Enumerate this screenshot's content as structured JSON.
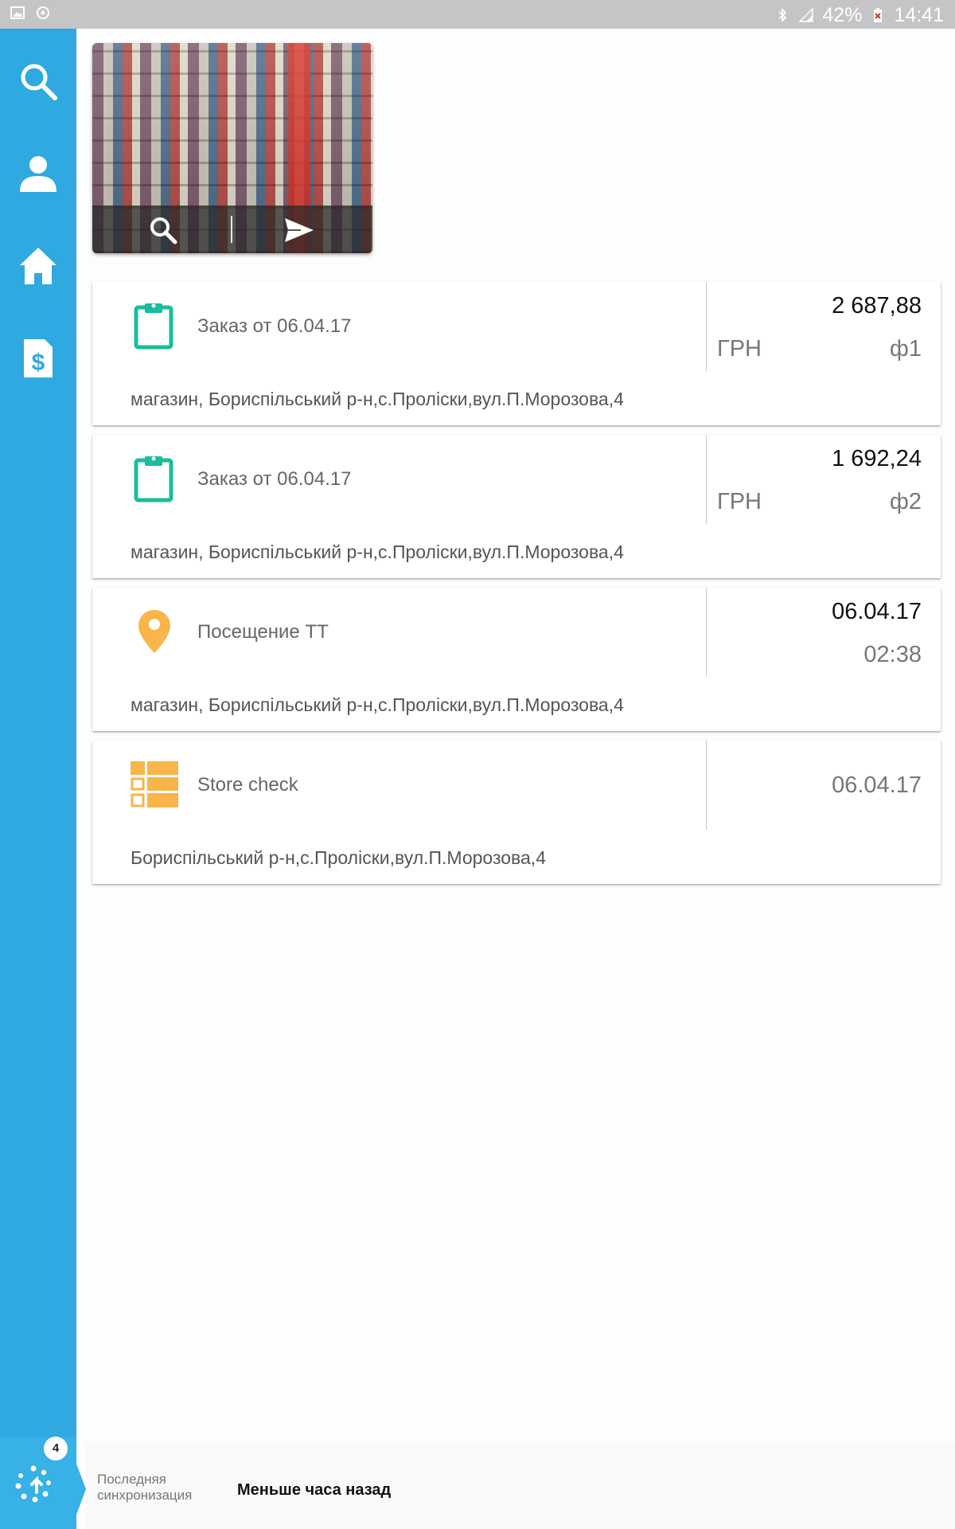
{
  "status_bar": {
    "battery": "42%",
    "time": "14:41"
  },
  "sidebar": {
    "items": [
      {
        "name": "search"
      },
      {
        "name": "profile"
      },
      {
        "name": "home"
      },
      {
        "name": "finance"
      }
    ],
    "sync_badge": "4"
  },
  "cards": [
    {
      "title": "Заказ от 06.04.17",
      "amount": "2 687,88",
      "currency": "ГРН",
      "sub": "ф1",
      "address": "магазин, Бориспільський р-н,с.Проліски,вул.П.Морозова,4"
    },
    {
      "title": "Заказ от 06.04.17",
      "amount": "1 692,24",
      "currency": "ГРН",
      "sub": "ф2",
      "address": "магазин, Бориспільський р-н,с.Проліски,вул.П.Морозова,4"
    },
    {
      "title": "Посещение ТТ",
      "date": "06.04.17",
      "time": "02:38",
      "address": "магазин, Бориспільський р-н,с.Проліски,вул.П.Морозова,4"
    },
    {
      "title": "Store check",
      "date": "06.04.17",
      "address": "Бориспільський р-н,с.Проліски,вул.П.Морозова,4"
    }
  ],
  "footer": {
    "label": "Последняя синхронизация",
    "value": "Меньше часа назад"
  },
  "colors": {
    "sidebar": "#2fa9df",
    "order_icon": "#1abc9c",
    "visit_icon": "#f7b54a",
    "storecheck_icon": "#f7b54a"
  }
}
